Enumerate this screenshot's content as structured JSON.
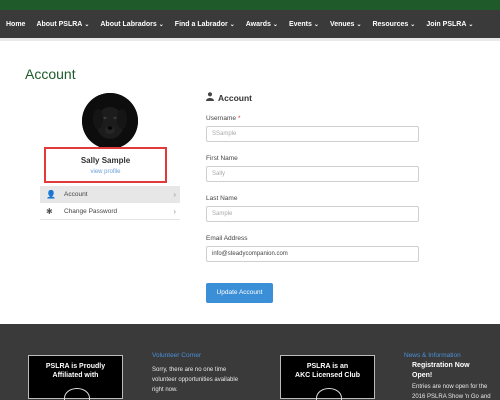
{
  "nav": {
    "items": [
      {
        "label": "Home",
        "chevron": false
      },
      {
        "label": "About PSLRA",
        "chevron": true
      },
      {
        "label": "About Labradors",
        "chevron": true
      },
      {
        "label": "Find a Labrador",
        "chevron": true
      },
      {
        "label": "Awards",
        "chevron": true
      },
      {
        "label": "Events",
        "chevron": true
      },
      {
        "label": "Venues",
        "chevron": true
      },
      {
        "label": "Resources",
        "chevron": true
      },
      {
        "label": "Join PSLRA",
        "chevron": true
      }
    ],
    "chevron_glyph": "⌄"
  },
  "page": {
    "title": "Account"
  },
  "profile": {
    "name": "Sally Sample",
    "link": "view profile",
    "avatar_icon": "black-labrador-photo"
  },
  "side_menu": [
    {
      "label": "Account",
      "icon": "user-icon",
      "glyph": "👤"
    },
    {
      "label": "Change Password",
      "icon": "asterisk-icon",
      "glyph": "✱"
    }
  ],
  "form": {
    "heading": "Account",
    "fields": [
      {
        "label": "Username",
        "required": true,
        "value": "",
        "placeholder": "SSample"
      },
      {
        "label": "First Name",
        "required": false,
        "value": "",
        "placeholder": "Sally"
      },
      {
        "label": "Last Name",
        "required": false,
        "value": "",
        "placeholder": "Sample"
      },
      {
        "label": "Email Address",
        "required": false,
        "value": "info@steadycompanion.com",
        "placeholder": ""
      }
    ],
    "submit_label": "Update Account"
  },
  "footer": {
    "badge1": {
      "line1": "PSLRA is Proudly",
      "line2": "Affiliated with"
    },
    "col2_head": "Volunteer Corner",
    "col2_text": [
      "Sorry, there are no one time",
      "volunteer opportunities available",
      "right now."
    ],
    "badge2": {
      "line1": "PSLRA is an",
      "line2": "AKC Licensed Club"
    },
    "col4_head": "News & Information",
    "col4_bold": [
      "Registration Now",
      "Open!"
    ],
    "col4_text": [
      "Entries are now open for the",
      "2016 PSLRA Show 'n Go and"
    ]
  },
  "colors": {
    "brand_green": "#1f5a2a",
    "accent_blue": "#3b8fd6",
    "highlight_red": "#e03a3a"
  }
}
